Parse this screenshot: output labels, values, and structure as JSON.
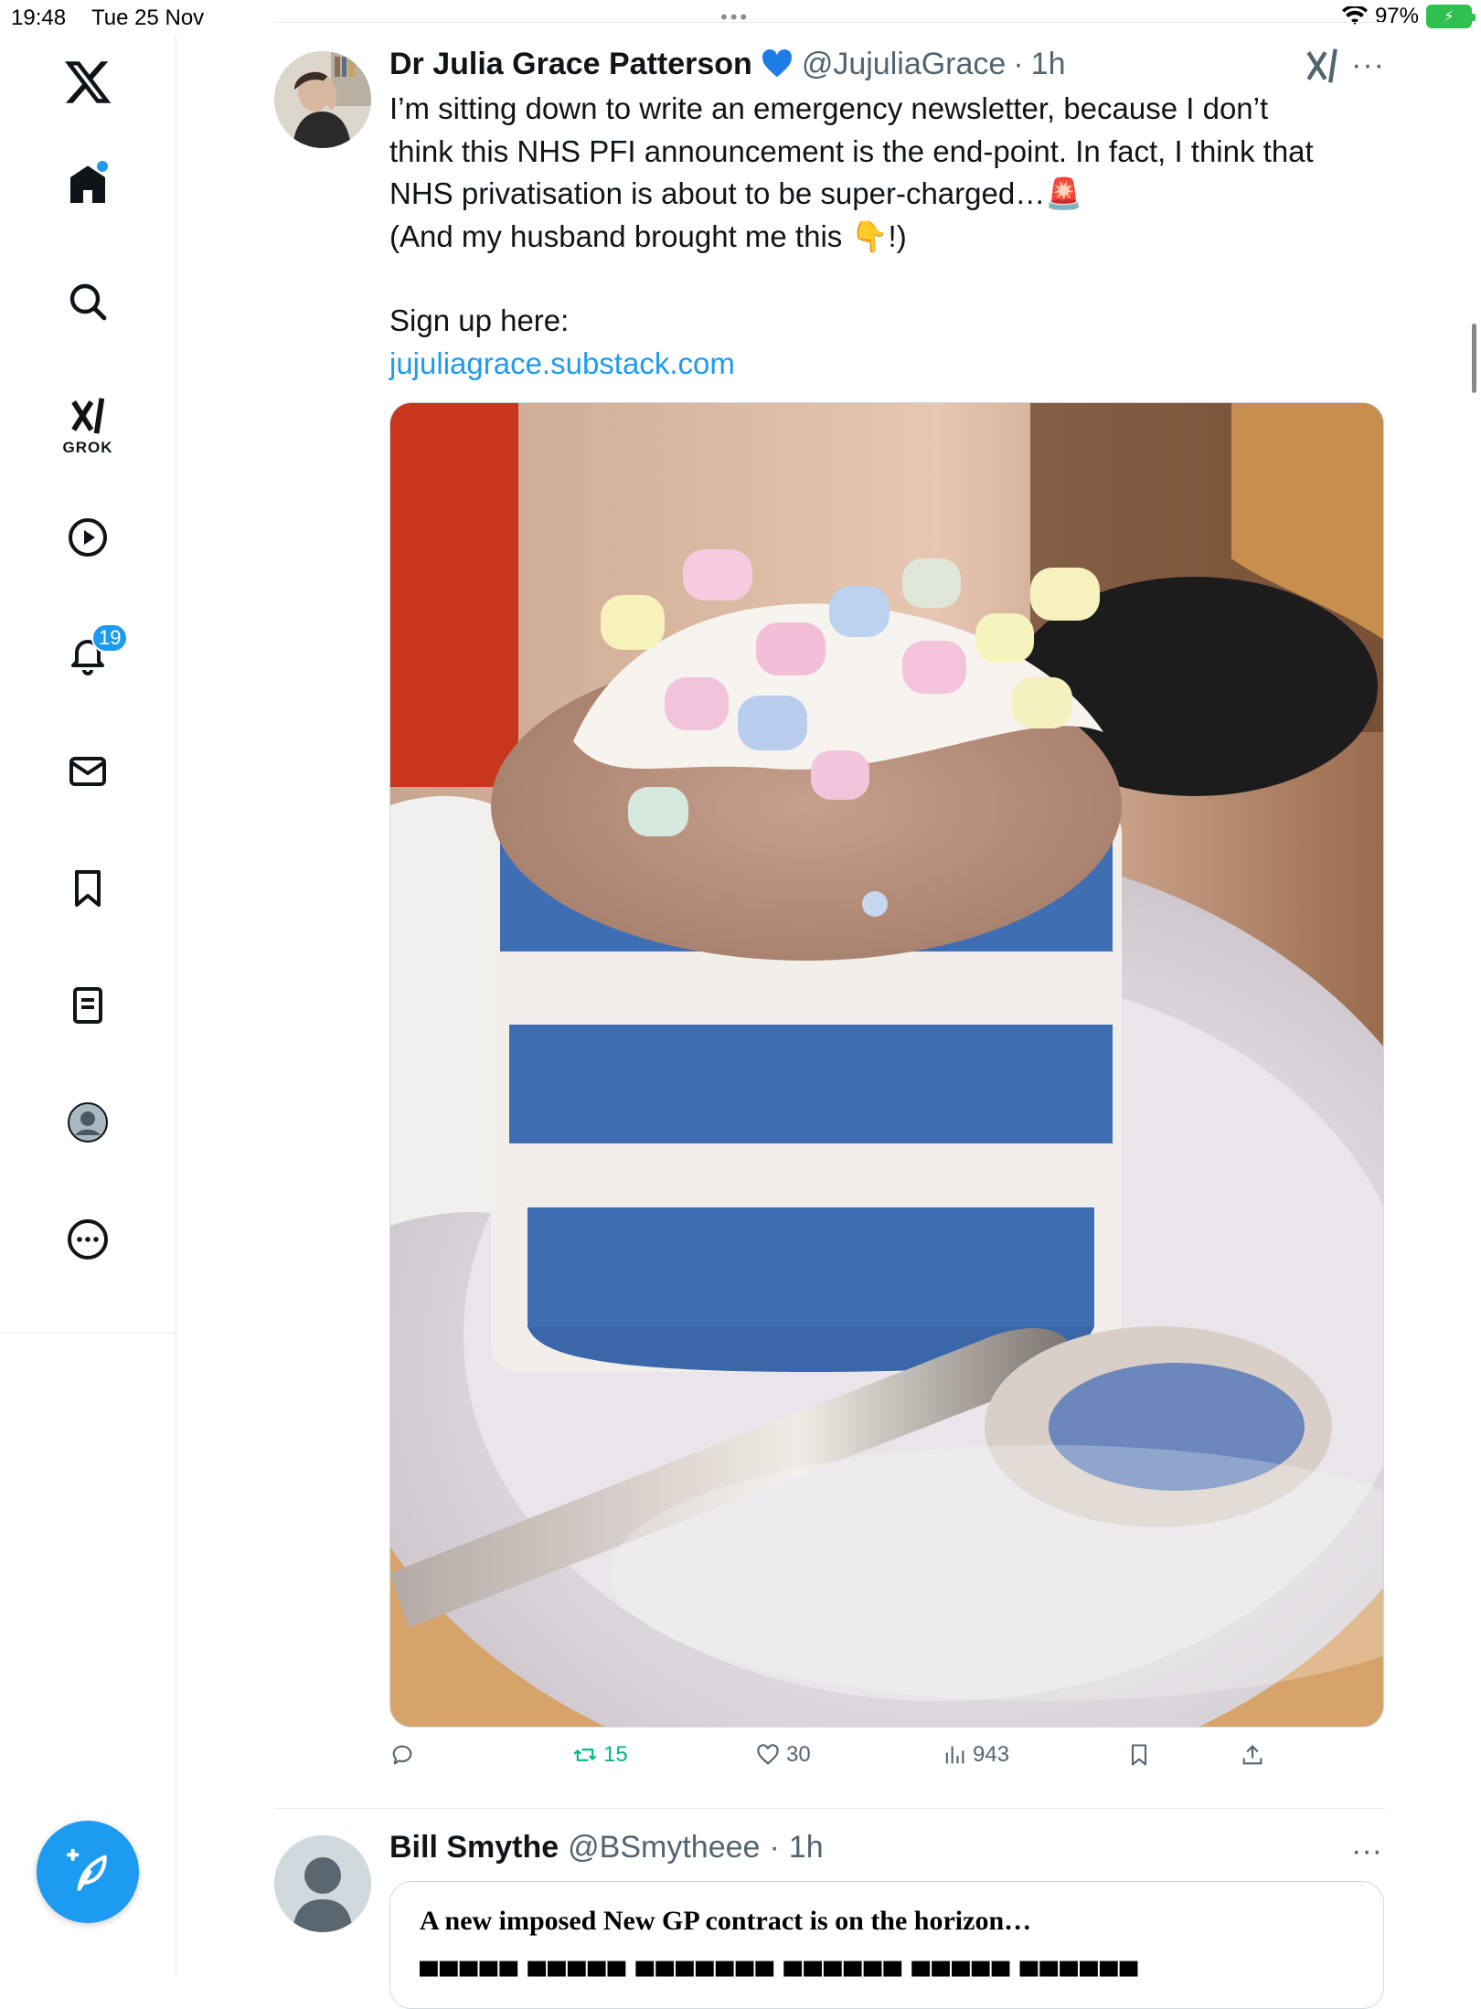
{
  "status_bar": {
    "time": "19:48",
    "date": "Tue 25 Nov",
    "battery": "97%",
    "center_dots": "•••"
  },
  "sidebar": {
    "items": [
      {
        "name": "x-logo",
        "icon": "x-logo-icon"
      },
      {
        "name": "home",
        "icon": "home-icon",
        "unread_dot": true
      },
      {
        "name": "search",
        "icon": "search-icon"
      },
      {
        "name": "grok",
        "icon": "grok-icon",
        "label": "GROK"
      },
      {
        "name": "video",
        "icon": "play-icon"
      },
      {
        "name": "notifications",
        "icon": "bell-icon",
        "badge": "19"
      },
      {
        "name": "messages",
        "icon": "envelope-icon"
      },
      {
        "name": "bookmarks",
        "icon": "bookmark-icon"
      },
      {
        "name": "articles",
        "icon": "document-icon"
      },
      {
        "name": "profile",
        "icon": "avatar-icon"
      },
      {
        "name": "more",
        "icon": "ellipsis-circle-icon"
      }
    ],
    "compose_icon": "compose-feather-icon"
  },
  "tweet": {
    "display_name": "Dr Julia Grace Patterson",
    "verified_icon": "blue-heart-icon",
    "handle": "@JujuliaGrace",
    "separator": "·",
    "time": "1h",
    "text_lines": [
      "I’m sitting down to write an emergency newsletter, because I don’t",
      "think this NHS PFI announcement is the end-point. In fact, I think that",
      "NHS privatisation is about to be super-charged…",
      "(And my husband brought me this",
      "!)"
    ],
    "emoji_siren": "🚨",
    "emoji_pointing": "👇",
    "signup": "Sign up here:",
    "link": "jujuliagrace.substack.com",
    "actions": {
      "reply": "",
      "retweets": "15",
      "likes": "30",
      "views": "943"
    }
  },
  "tweet2": {
    "display_name": "Bill Smythe",
    "handle": "@BSmytheee",
    "separator": "·",
    "time": "1h",
    "card_title": "A new imposed New GP contract is on the horizon…"
  },
  "colors": {
    "accent": "#1d9bf0",
    "retweet_green": "#00ba7c",
    "muted_text": "#536471"
  }
}
